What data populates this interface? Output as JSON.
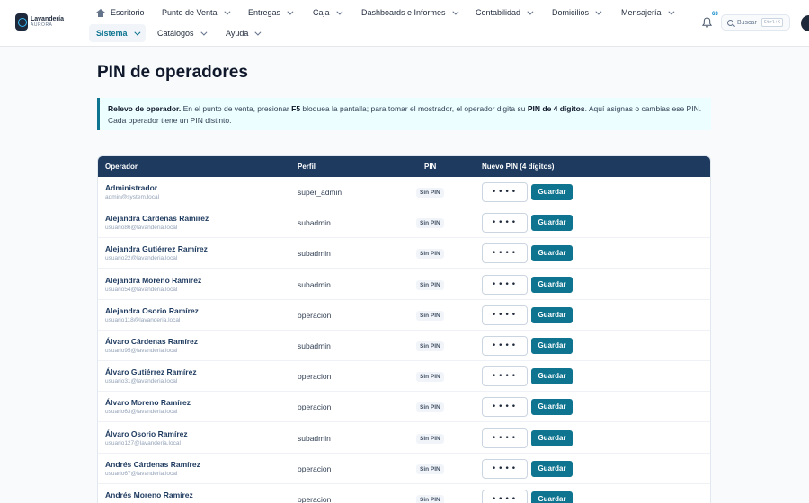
{
  "brand": {
    "name": "Lavandería",
    "sub": "AURORA"
  },
  "nav": {
    "home": "Escritorio",
    "top": [
      "Punto de Venta",
      "Entregas",
      "Caja",
      "Dashboards e Informes",
      "Contabilidad",
      "Domicilios",
      "Mensajería"
    ],
    "bottom": [
      "Sistema",
      "Catálogos",
      "Ayuda"
    ]
  },
  "notifications": {
    "count": "63"
  },
  "search": {
    "label": "Buscar",
    "shortcut": "Ctrl+K"
  },
  "page": {
    "title": "PIN de operadores",
    "callout": {
      "lead": "Relevo de operador.",
      "t1": " En el punto de venta, presionar ",
      "key": "F5",
      "t2": " bloquea la pantalla; para tomar el mostrador, el operador digita su ",
      "pin": "PIN de 4 dígitos",
      "t3": ". Aquí asignas o cambias ese PIN. Cada operador tiene un PIN distinto."
    }
  },
  "table": {
    "headers": {
      "operador": "Operador",
      "perfil": "Perfil",
      "pin": "PIN",
      "nuevo": "Nuevo PIN (4 dígitos)"
    },
    "placeholder": "••••",
    "save_label": "Guardar",
    "rows": [
      {
        "name": "Administrador",
        "email": "admin@system.local",
        "perfil": "super_admin",
        "pin": "Sin PIN"
      },
      {
        "name": "Alejandra Cárdenas Ramírez",
        "email": "usuario86@lavanderia.local",
        "perfil": "subadmin",
        "pin": "Sin PIN"
      },
      {
        "name": "Alejandra Gutiérrez Ramírez",
        "email": "usuario22@lavanderia.local",
        "perfil": "subadmin",
        "pin": "Sin PIN"
      },
      {
        "name": "Alejandra Moreno Ramírez",
        "email": "usuario54@lavanderia.local",
        "perfil": "subadmin",
        "pin": "Sin PIN"
      },
      {
        "name": "Alejandra Osorio Ramírez",
        "email": "usuario118@lavanderia.local",
        "perfil": "operacion",
        "pin": "Sin PIN"
      },
      {
        "name": "Álvaro Cárdenas Ramírez",
        "email": "usuario95@lavanderia.local",
        "perfil": "subadmin",
        "pin": "Sin PIN"
      },
      {
        "name": "Álvaro Gutiérrez Ramírez",
        "email": "usuario31@lavanderia.local",
        "perfil": "operacion",
        "pin": "Sin PIN"
      },
      {
        "name": "Álvaro Moreno Ramírez",
        "email": "usuario63@lavanderia.local",
        "perfil": "operacion",
        "pin": "Sin PIN"
      },
      {
        "name": "Álvaro Osorio Ramírez",
        "email": "usuario127@lavanderia.local",
        "perfil": "subadmin",
        "pin": "Sin PIN"
      },
      {
        "name": "Andrés Cárdenas Ramírez",
        "email": "usuario67@lavanderia.local",
        "perfil": "operacion",
        "pin": "Sin PIN"
      },
      {
        "name": "Andrés Moreno Ramírez",
        "email": "",
        "perfil": "operacion",
        "pin": "Sin PIN"
      }
    ]
  }
}
